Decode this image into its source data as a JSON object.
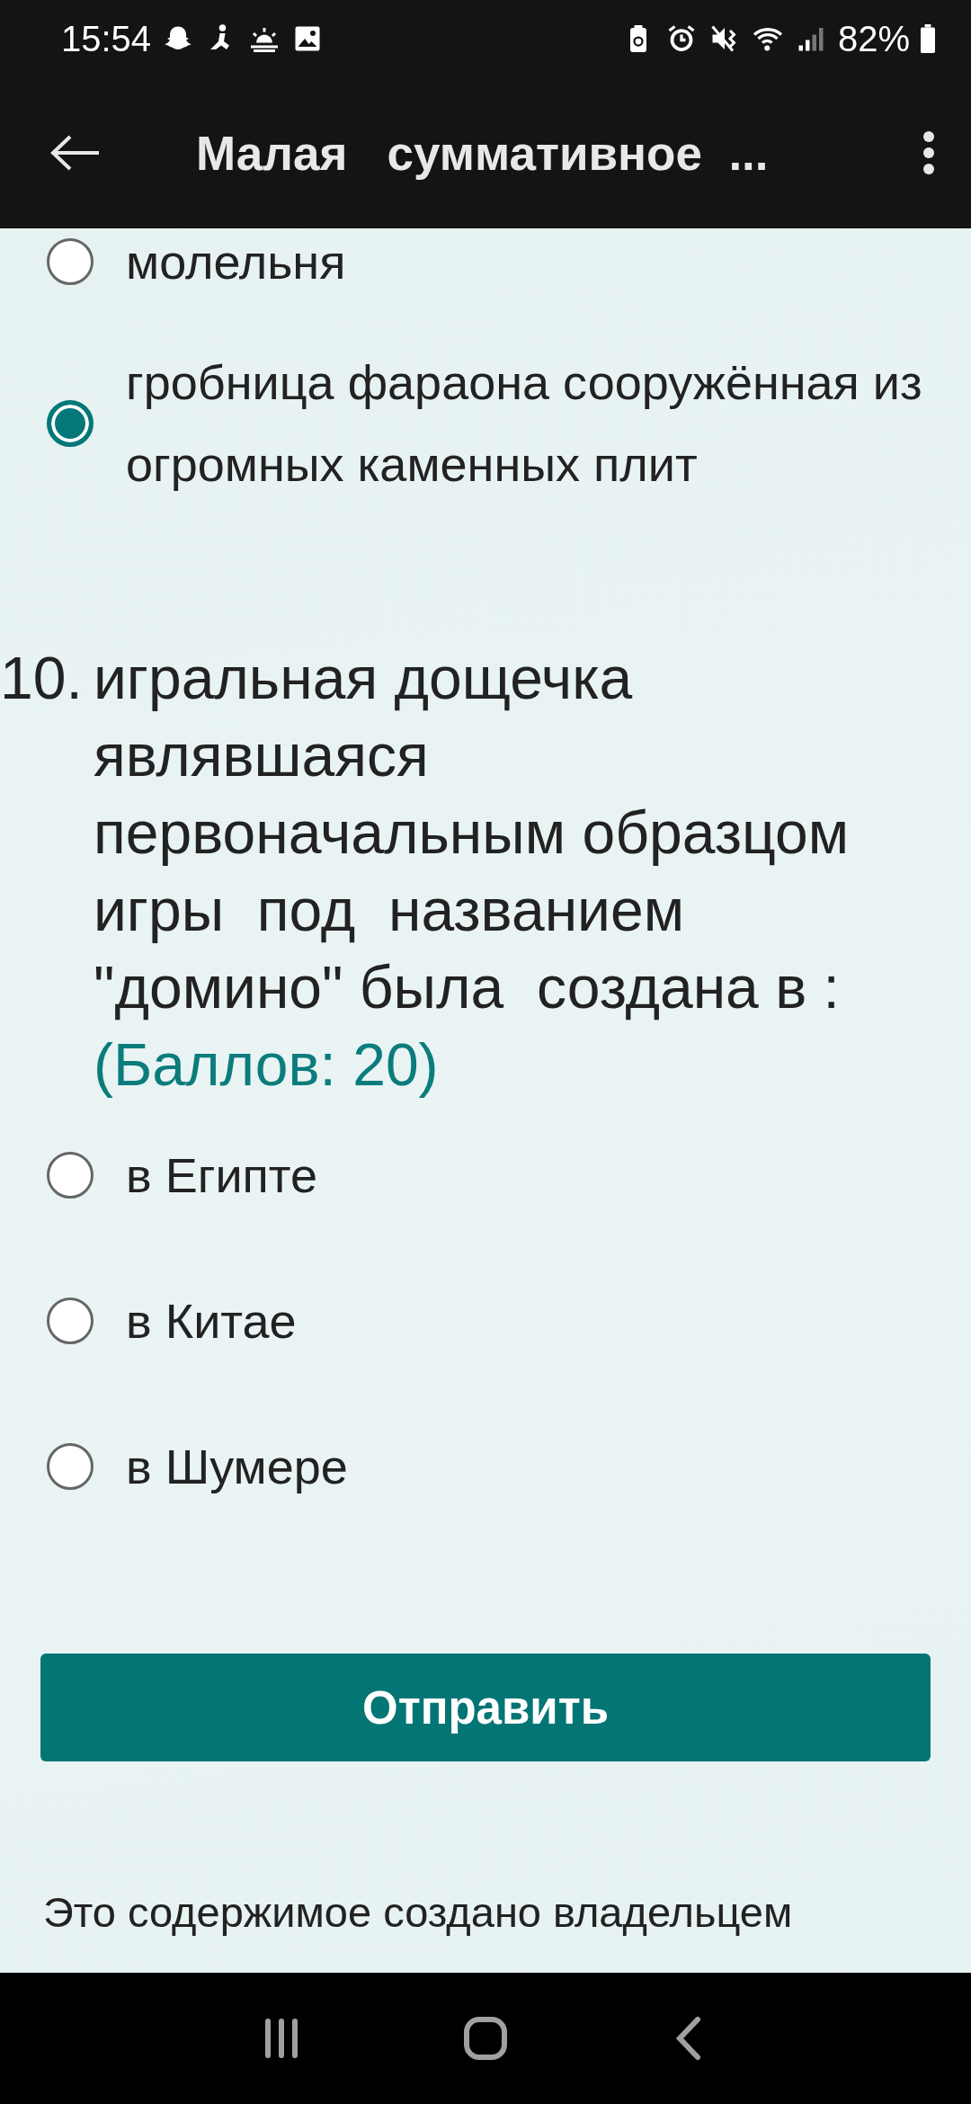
{
  "status_bar": {
    "time": "15:54",
    "battery": "82%"
  },
  "app_bar": {
    "title": "Малая   суммативное  ..."
  },
  "previous_options": [
    {
      "label": "молельня",
      "selected": false
    },
    {
      "label": "гробница фараона сооружённая из огромных каменных плит",
      "selected": true
    }
  ],
  "question": {
    "number": "10.",
    "text": "игральная дощечка являвшаяся первоначальным образцом игры  под  названием \"домино\" была  создана в :",
    "points": "(Баллов: 20)",
    "options": [
      {
        "label": "в Египте",
        "selected": false
      },
      {
        "label": "в Китае",
        "selected": false
      },
      {
        "label": "в Шумере",
        "selected": false
      }
    ]
  },
  "submit_button": "Отправить",
  "footer": "Это содержимое создано владельцем"
}
